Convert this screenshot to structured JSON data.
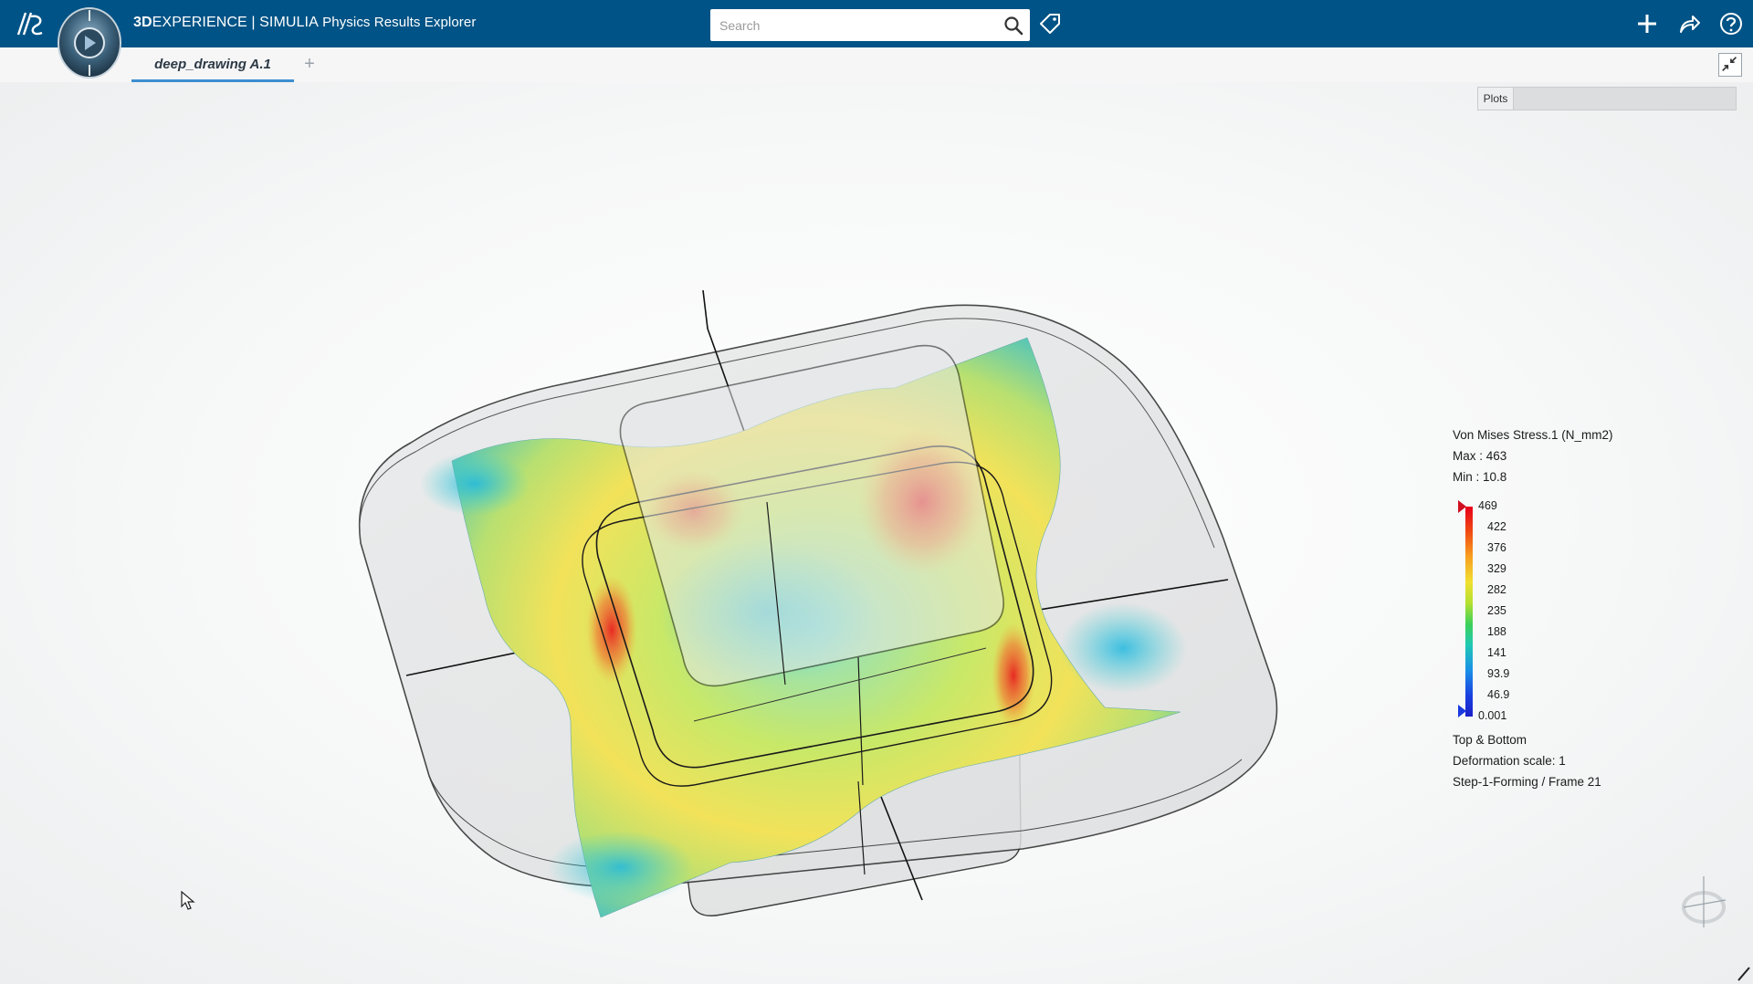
{
  "header": {
    "brand_bold": "3D",
    "brand_rest": "EXPERIENCE",
    "separator": " | ",
    "product": "SIMULIA",
    "app_name": " Physics Results Explorer",
    "logo_icon": "ds-logo-icon",
    "compass_icon": "compass-icon"
  },
  "search": {
    "placeholder": "Search",
    "value": ""
  },
  "toolbar_icons": [
    "tag-icon",
    "plus-icon",
    "share-icon",
    "help-icon"
  ],
  "tabs": [
    {
      "label": "deep_drawing A.1",
      "active": true
    }
  ],
  "tab_add_label": "+",
  "plots": {
    "label": "Plots"
  },
  "legend": {
    "title": "Von Mises Stress.1 (N_mm2)",
    "max": "Max : 463",
    "min": "Min : 10.8",
    "ticks": [
      "469",
      "422",
      "376",
      "329",
      "282",
      "235",
      "188",
      "141",
      "93.9",
      "46.9",
      "0.001"
    ],
    "info": [
      "Top & Bottom",
      "Deformation scale: 1",
      "Step-1-Forming / Frame 21"
    ]
  },
  "colors": {
    "header_bg": "#005386",
    "tab_accent": "#3d8ed0",
    "stress_high": "#e8001c",
    "stress_low": "#1a20c8"
  }
}
